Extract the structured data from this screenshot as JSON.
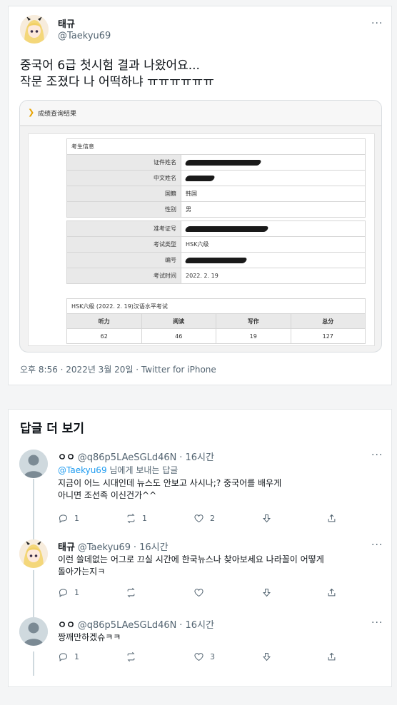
{
  "tweet": {
    "name": "태규",
    "handle": "@Taekyu69",
    "more": "···",
    "text": "중국어 6급 첫시험 결과 나왔어요...\n작문 조졌다 나 어떡하냐 ㅠㅠㅠㅠㅠㅠ",
    "timestamp": "오후 8:56 · 2022년 3월 20일 · Twitter for iPhone",
    "image": {
      "header_title": "成绩查询结果",
      "section_title": "考生信息",
      "fields": [
        {
          "label": "证件姓名",
          "value": ""
        },
        {
          "label": "中文姓名",
          "value": ""
        },
        {
          "label": "国籍",
          "value": "韩国"
        },
        {
          "label": "性别",
          "value": "男"
        },
        {
          "label": "准考证号",
          "value": ""
        },
        {
          "label": "考试类型",
          "value": "HSK六级"
        },
        {
          "label": "编号",
          "value": ""
        },
        {
          "label": "考试时间",
          "value": "2022. 2. 19"
        }
      ],
      "score_caption": "HSK六级 (2022. 2. 19)汉语水平考试",
      "score_headers": [
        "听力",
        "阅读",
        "写作",
        "总分"
      ],
      "score_values": [
        "62",
        "46",
        "19",
        "127"
      ]
    }
  },
  "replies_section": {
    "title": "답글 더 보기",
    "replies": [
      {
        "name": "ㅇㅇ",
        "handle": "@q86p5LAeSGLd46N",
        "time": "· 16시간",
        "replying_to_handle": "@Taekyu69",
        "replying_to_suffix": " 님에게 보내는 답글",
        "text": "지금이 어느 시대인데 뉴스도 안보고 사시나;? 중국어를 배우게\n아니면 조선족 이신건가^^",
        "reply_count": "1",
        "retweet_count": "1",
        "like_count": "2"
      },
      {
        "name": "태규",
        "handle": "@Taekyu69",
        "time": "· 16시간",
        "text": "이런 쓸데없는 어그로 끄실 시간에 한국뉴스나 찾아보세요 나라꼴이 어떻게\n돌아가는지ㅋ",
        "reply_count": "1",
        "retweet_count": "",
        "like_count": ""
      },
      {
        "name": "ㅇㅇ",
        "handle": "@q86p5LAeSGLd46N",
        "time": "· 16시간",
        "text": "짱깨만하겠슈ㅋㅋ",
        "reply_count": "1",
        "retweet_count": "",
        "like_count": "3"
      }
    ]
  },
  "colors": {
    "link": "#1d9bf0",
    "muted": "#536471",
    "text": "#0f1419",
    "header_chevron": "#e8a300"
  },
  "icons": [
    "reply-icon",
    "retweet-icon",
    "like-icon",
    "share-icon",
    "more-icon",
    "default-avatar-icon"
  ]
}
